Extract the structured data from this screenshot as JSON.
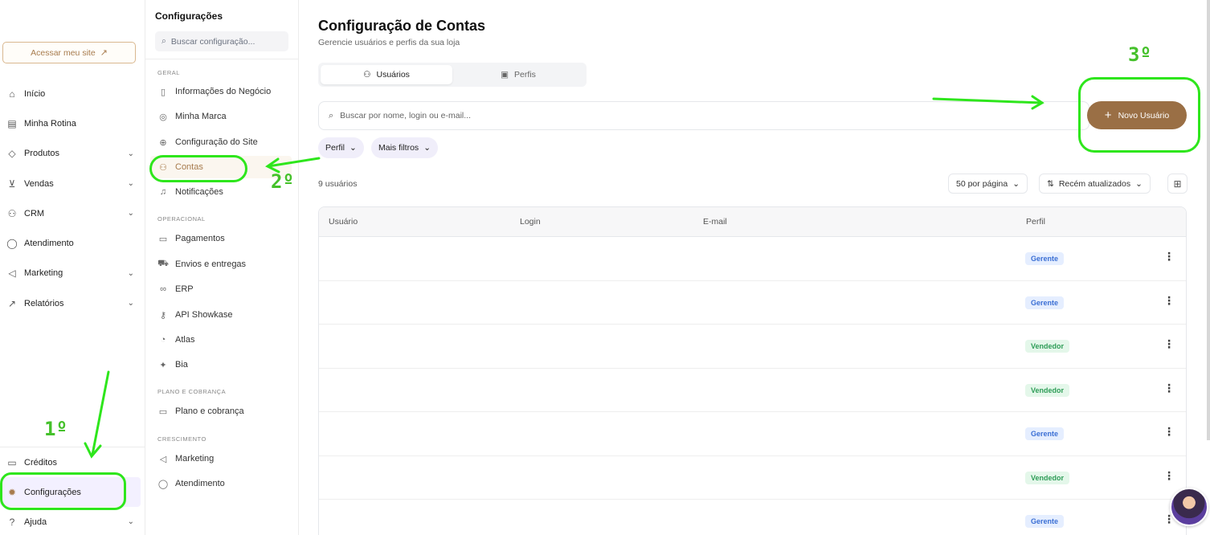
{
  "sidebar": {
    "site_button": "Acessar meu site",
    "items": [
      {
        "label": "Início",
        "icon": "home-icon",
        "chevron": false
      },
      {
        "label": "Minha Rotina",
        "icon": "calendar-icon",
        "chevron": false
      },
      {
        "label": "Produtos",
        "icon": "tag-icon",
        "chevron": true
      },
      {
        "label": "Vendas",
        "icon": "cart-icon",
        "chevron": true
      },
      {
        "label": "CRM",
        "icon": "users-icon",
        "chevron": true
      },
      {
        "label": "Atendimento",
        "icon": "chat-icon",
        "chevron": false
      },
      {
        "label": "Marketing",
        "icon": "megaphone-icon",
        "chevron": true
      },
      {
        "label": "Relatórios",
        "icon": "chart-icon",
        "chevron": true
      }
    ],
    "bottom_items": [
      {
        "label": "Créditos",
        "icon": "card-icon"
      },
      {
        "label": "Configurações",
        "icon": "gear-icon",
        "active": true
      },
      {
        "label": "Ajuda",
        "icon": "help-icon"
      }
    ]
  },
  "settings_panel": {
    "title": "Configurações",
    "search_placeholder": "Buscar configuração...",
    "sections": [
      {
        "label": "GERAL",
        "items": [
          "Informações do Negócio",
          "Minha Marca",
          "Configuração do Site",
          "Contas",
          "Notificações"
        ]
      },
      {
        "label": "OPERACIONAL",
        "items": [
          "Pagamentos",
          "Envios e entregas",
          "ERP",
          "API Showkase",
          "Atlas",
          "Bia"
        ]
      },
      {
        "label": "PLANO E COBRANÇA",
        "items": [
          "Plano e cobrança"
        ]
      },
      {
        "label": "CRESCIMENTO",
        "items": [
          "Marketing",
          "Atendimento"
        ]
      }
    ],
    "active_item": "Contas"
  },
  "main": {
    "title": "Configuração de Contas",
    "subtitle": "Gerencie usuários e perfis da sua loja",
    "tabs": [
      {
        "label": "Usuários",
        "active": true
      },
      {
        "label": "Perfis",
        "active": false
      }
    ],
    "search_placeholder": "Buscar por nome, login ou e-mail...",
    "new_button": "Novo Usuário",
    "filters": [
      "Perfil",
      "Mais filtros"
    ],
    "count": "9 usuários",
    "per_page": "50 por página",
    "sort": "Recém atualizados",
    "columns": [
      "Usuário",
      "Login",
      "E-mail",
      "Perfil"
    ],
    "rows": [
      {
        "perfil": "Gerente"
      },
      {
        "perfil": "Gerente"
      },
      {
        "perfil": "Vendedor"
      },
      {
        "perfil": "Vendedor"
      },
      {
        "perfil": "Gerente"
      },
      {
        "perfil": "Vendedor"
      },
      {
        "perfil": "Gerente"
      }
    ]
  },
  "annotations": {
    "step1": "1º",
    "step2": "2º",
    "step3": "3º"
  },
  "colors": {
    "accent": "#9a6f45",
    "annotation": "#2ee61c"
  }
}
